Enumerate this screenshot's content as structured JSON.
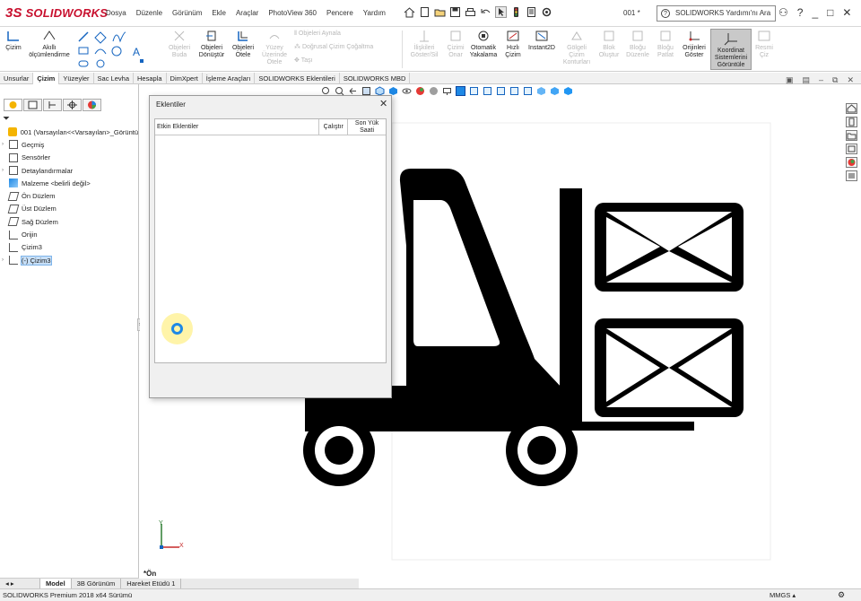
{
  "app": {
    "logo_prefix": "3S",
    "logo_text": "SOLIDWORKS",
    "doc_name": "001 *"
  },
  "menu": [
    "Dosya",
    "Düzenle",
    "Görünüm",
    "Ekle",
    "Araçlar",
    "PhotoView 360",
    "Pencere",
    "Yardım"
  ],
  "search": {
    "placeholder": "SOLIDWORKS Yardımı'nı Ara"
  },
  "window_controls": {
    "help": "?",
    "minimize": "_",
    "restore": "□",
    "close": "✕"
  },
  "ribbon": {
    "cizim": "Çizim",
    "akilli": "Akıllı ölçümlendirme",
    "obj_buda": "Objeleri Buda",
    "obj_donustur": "Objeleri Dönüştür",
    "obj_otele": "Objeleri Ötele",
    "yuzey_otele": "Yüzey Üzerinde Ötele",
    "aynala": "Objeleri Aynala",
    "dogrusal": "Doğrusal Çizim Çoğaltma",
    "tasi": "Taşı",
    "iliski": "İlişkileri Göster/Sil",
    "cizimi_onar": "Çizimi Onar",
    "otomatik": "Otomatik Yakalama",
    "hizli": "Hızlı Çizim",
    "instant": "Instant2D",
    "golgeli": "Gölgeli Çizim Konturları",
    "blok_olustur": "Blok Oluştur",
    "blogu_duzenle": "Bloğu Düzenle",
    "blogu_patlat": "Bloğu Patlat",
    "orijinleri": "Orijinleri Göster",
    "koordinat": "Koordinat Sistemlerini Görüntüle",
    "resmi_cis": "Resmi Çiz"
  },
  "tabs": [
    "Unsurlar",
    "Çizim",
    "Yüzeyler",
    "Sac Levha",
    "Hesapla",
    "DimXpert",
    "İşleme Araçları",
    "SOLIDWORKS Eklentileri",
    "SOLIDWORKS MBD"
  ],
  "selected_tab": "Çizim",
  "tree": [
    {
      "label": "001  (Varsayılan<<Varsayılan>_Görüntü",
      "twisty": ""
    },
    {
      "label": "Geçmiş",
      "twisty": "›"
    },
    {
      "label": "Sensörler",
      "twisty": ""
    },
    {
      "label": "Detaylandırmalar",
      "twisty": "›"
    },
    {
      "label": "Malzeme <belirli değil>",
      "twisty": ""
    },
    {
      "label": "Ön Düzlem",
      "twisty": ""
    },
    {
      "label": "Üst Düzlem",
      "twisty": ""
    },
    {
      "label": "Sağ Düzlem",
      "twisty": ""
    },
    {
      "label": "Orijin",
      "twisty": ""
    },
    {
      "label": "Çizim3",
      "twisty": ""
    },
    {
      "label": "(-) Çizim3",
      "twisty": "›"
    }
  ],
  "dialog": {
    "title": "Eklentiler",
    "close": "✕",
    "col_active": "Etkin Eklentiler",
    "col_start": "Çalıştır",
    "col_last": "Son Yük Saati"
  },
  "view": {
    "name": "*Ön",
    "triad_x": "X",
    "triad_y": "Y"
  },
  "model_tabs": [
    "Model",
    "3B Görünüm",
    "Hareket Etüdü 1"
  ],
  "status": {
    "left": "SOLIDWORKS Premium 2018 x64 Sürümü",
    "units": "MMGS  ▴"
  }
}
